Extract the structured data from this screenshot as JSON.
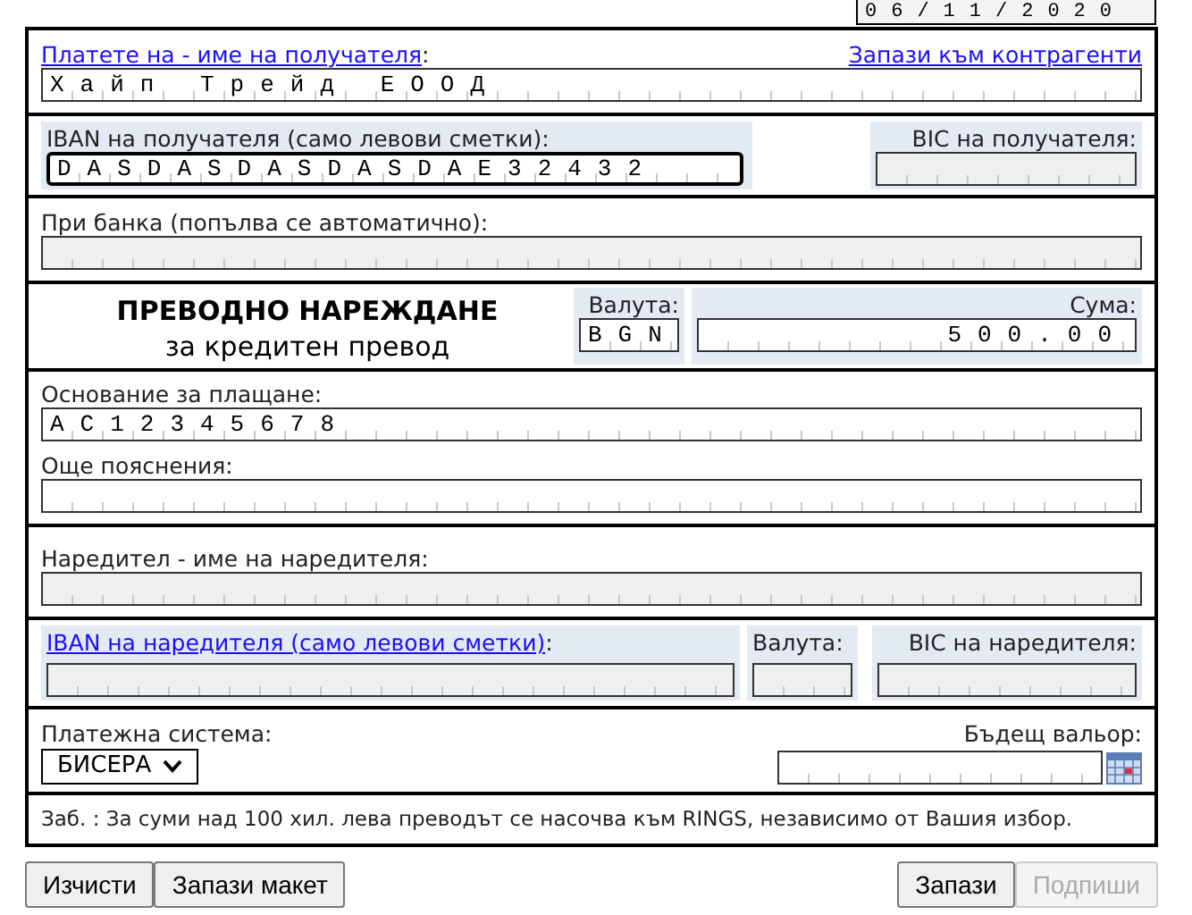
{
  "date_field": {
    "value": "06/11/2020"
  },
  "recipient": {
    "label_link": "Платете на - име на получателя",
    "label_suffix": ":",
    "save_link": "Запази към контрагенти",
    "field": {
      "value": "Хайп Трейд ЕООД",
      "disabled": false,
      "focused": false
    }
  },
  "recipient_iban": {
    "label": "IBAN на получателя (само левови сметки):",
    "field": {
      "value": "DASDASDASDASDAE32432",
      "disabled": false,
      "focused": true
    }
  },
  "recipient_bic": {
    "label": "BIC на получателя:",
    "field": {
      "disabled": true,
      "focused": false
    }
  },
  "bank": {
    "label": "При банка (попълва се автоматично):",
    "field": {
      "disabled": true,
      "focused": false
    }
  },
  "title": "ПРЕВОДНО НАРЕЖДАНЕ",
  "subtitle": "за кредитен превод",
  "currency": {
    "label": "Валута:",
    "field": {
      "value": "BGN",
      "disabled": false,
      "focused": false
    }
  },
  "amount": {
    "label": "Сума:",
    "field": {
      "value": "500.00",
      "disabled": false,
      "focused": false
    }
  },
  "purpose": {
    "label": "Основание за плащане:",
    "field": {
      "value": "AC12345678",
      "disabled": false,
      "focused": false
    }
  },
  "details": {
    "label": "Още пояснения:",
    "field": {
      "disabled": false,
      "focused": false
    }
  },
  "orderer": {
    "label": "Наредител - име на наредителя:",
    "field": {
      "disabled": true,
      "focused": false
    }
  },
  "orderer_iban": {
    "label_link": "IBAN на наредителя (само левови сметки)",
    "label_suffix": ":",
    "field": {
      "disabled": true,
      "focused": false
    }
  },
  "orderer_currency": {
    "label": "Валута:",
    "field": {
      "disabled": true,
      "focused": false
    }
  },
  "orderer_bic": {
    "label": "BIC на наредителя:",
    "field": {
      "disabled": true,
      "focused": false
    }
  },
  "payment_system": {
    "label": "Платежна система:",
    "value": "БИСЕРА"
  },
  "value_date": {
    "label": "Бъдещ вальор:",
    "field": {
      "disabled": false,
      "focused": false
    }
  },
  "note": "Заб. : За суми над 100 хил. лева преводът се насочва към RINGS, независимо от Вашия избор.",
  "buttons_left": [
    {
      "label": "Изчисти",
      "disabled": false
    },
    {
      "label": "Запази макет",
      "disabled": false
    }
  ],
  "buttons_right": [
    {
      "label": "Запази",
      "disabled": false
    },
    {
      "label": "Подпиши",
      "disabled": true
    }
  ]
}
